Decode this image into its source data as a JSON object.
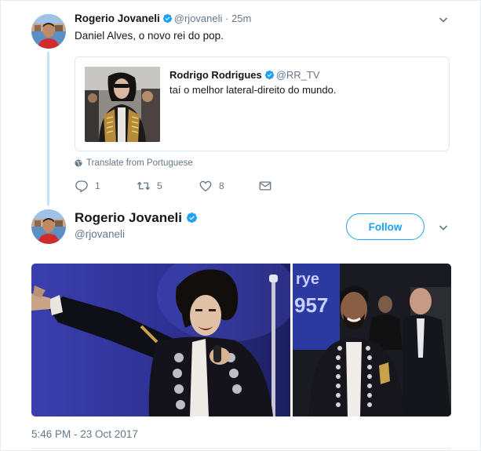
{
  "colors": {
    "link_blue": "#1da1f2",
    "muted": "#657786",
    "text": "#14171a",
    "thread_line": "#c4e3f8"
  },
  "tweet1": {
    "author_name": "Rogerio Jovaneli",
    "author_handle": "@rjovaneli",
    "separator": "·",
    "time": "25m",
    "text": "Daniel Alves, o novo rei do pop.",
    "verified_icon": "verified-badge-icon",
    "menu_icon": "chevron-down-icon",
    "quoted": {
      "author_name": "Rodrigo Rodrigues",
      "author_handle": "@RR_TV",
      "text": "taí o melhor lateral-direito do mundo."
    },
    "translate_label": "Translate from Portuguese",
    "actions": {
      "reply_count": "1",
      "retweet_count": "5",
      "like_count": "8"
    }
  },
  "tweet2": {
    "author_name": "Rogerio Jovaneli",
    "author_handle": "@rjovaneli",
    "follow_label": "Follow",
    "timestamp": "5:46 PM - 23 Oct 2017"
  }
}
